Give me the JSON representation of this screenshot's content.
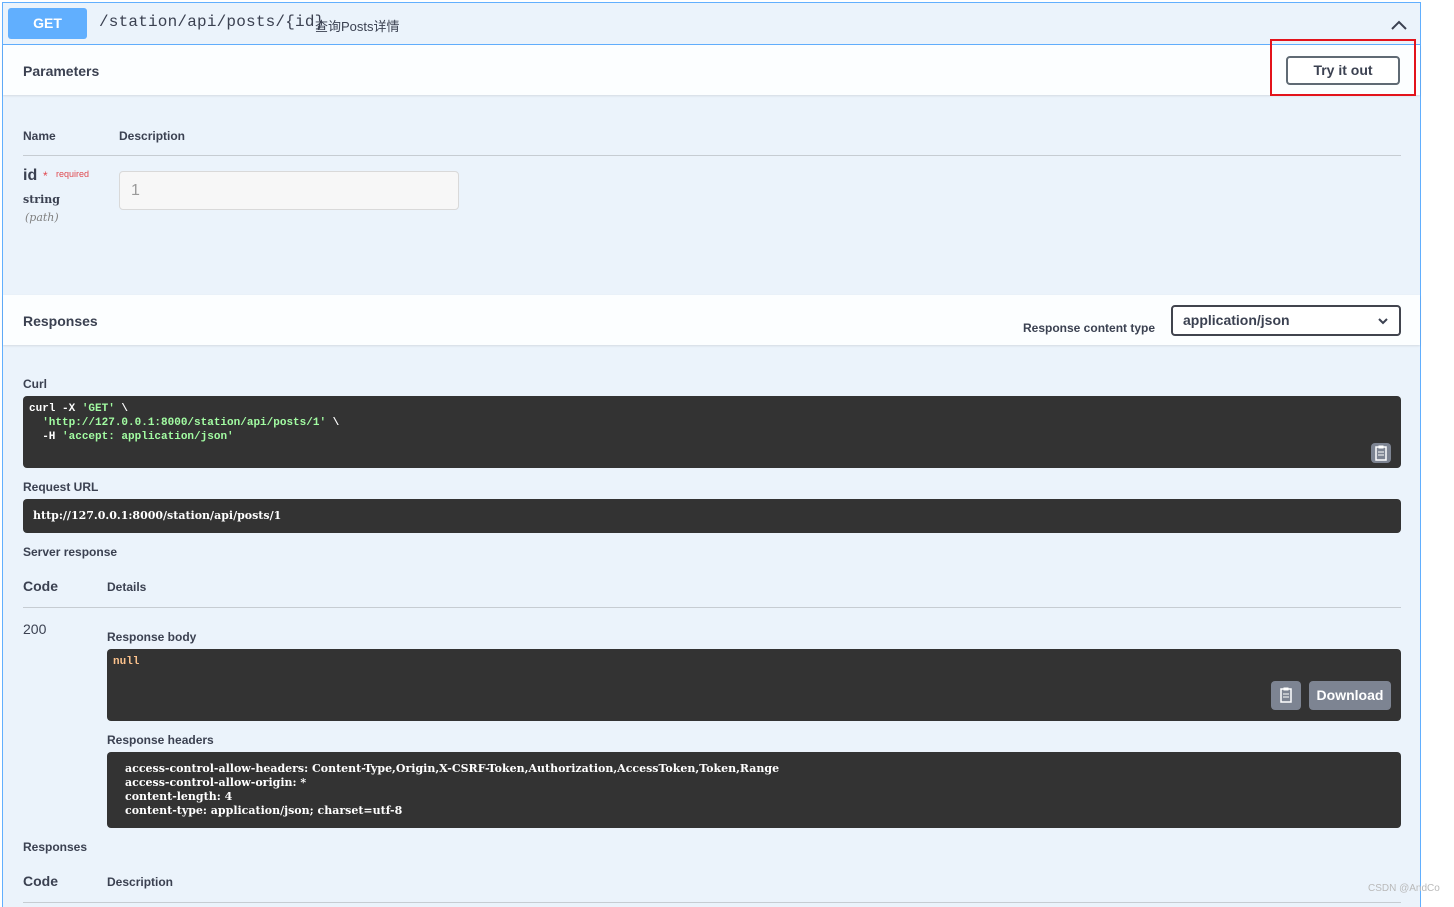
{
  "operation": {
    "method": "GET",
    "path": "/station/api/posts/{id}",
    "summary": "查询Posts详情"
  },
  "parameters": {
    "title": "Parameters",
    "try_label": "Try it out",
    "col_name": "Name",
    "col_description": "Description",
    "param": {
      "name": "id",
      "star": "*",
      "required": "required",
      "type": "string",
      "in": "(path)",
      "value": "1"
    }
  },
  "responses_section": {
    "title": "Responses",
    "content_type_label": "Response content type",
    "content_type_value": "application/json"
  },
  "curl": {
    "label": "Curl",
    "line1_prefix": "curl -X ",
    "line1_method": "'GET'",
    "line1_suffix": " \\",
    "line2_prefix": "  ",
    "line2_url": "'http://127.0.0.1:8000/station/api/posts/1'",
    "line2_suffix": " \\",
    "line3_prefix": "  -H ",
    "line3_header": "'accept: application/json'"
  },
  "request_url": {
    "label": "Request URL",
    "value": "http://127.0.0.1:8000/station/api/posts/1"
  },
  "server_response": {
    "label": "Server response",
    "col_code": "Code",
    "col_details": "Details",
    "code": "200",
    "body_label": "Response body",
    "body": "null",
    "download_label": "Download",
    "headers_label": "Response headers",
    "headers": [
      "access-control-allow-headers: Content-Type,Origin,X-CSRF-Token,Authorization,AccessToken,Token,Range",
      "access-control-allow-origin: *",
      "content-length: 4",
      "content-type: application/json; charset=utf-8"
    ]
  },
  "responses_table": {
    "label": "Responses",
    "col_code": "Code",
    "col_description": "Description"
  },
  "watermark": "CSDN @AndCo"
}
